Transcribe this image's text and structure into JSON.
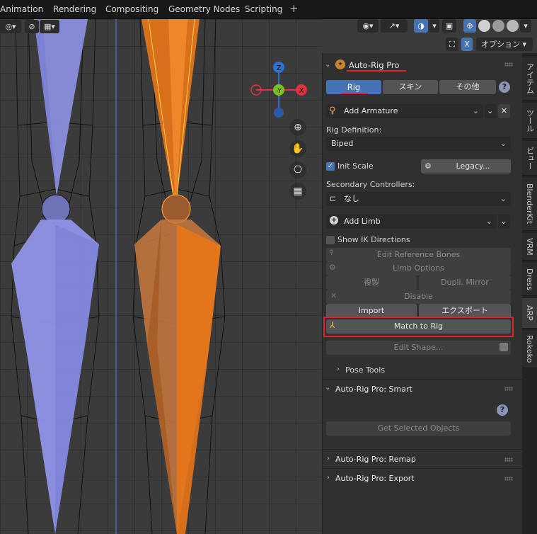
{
  "workspace_tabs": [
    "Animation",
    "Rendering",
    "Compositing",
    "Geometry Nodes",
    "Scripting"
  ],
  "add_workspace_label": "+",
  "header": {
    "view_mode_icon": "viewport-select-icon",
    "options_label": "オプション",
    "x_label": "X"
  },
  "gizmo": {
    "z": "Z",
    "y": "-Y",
    "x": "X"
  },
  "colors": {
    "accent": "#4772b3",
    "highlight_red": "#e0232e",
    "bone_blue": "#8f94e6",
    "bone_orange": "#e8751a"
  },
  "panel": {
    "title": "Auto-Rig Pro",
    "tabs": [
      "Rig",
      "スキン",
      "その他"
    ],
    "help_label": "?",
    "add_armature": "Add Armature",
    "close_label": "✕",
    "rig_definition_label": "Rig Definition:",
    "rig_definition_value": "Biped",
    "init_scale_label": "Init Scale",
    "legacy_label": "Legacy...",
    "secondary_label": "Secondary Controllers:",
    "secondary_value": "なし",
    "add_limb": "Add Limb",
    "show_ik_label": "Show IK Directions",
    "edit_reference_bones": "Edit Reference Bones",
    "limb_options": "Limb Options",
    "mirror_copy": "複製",
    "dupli_mirror": "Dupli. Mirror",
    "disable": "Disable",
    "import_label": "Import",
    "export_label": "エクスポート",
    "match_to_rig": "Match to Rig",
    "edit_shape": "Edit Shape...",
    "pose_tools": "Pose Tools",
    "smart_title": "Auto-Rig Pro: Smart",
    "get_selected": "Get Selected Objects",
    "remap_title": "Auto-Rig Pro: Remap",
    "export_title": "Auto-Rig Pro: Export"
  },
  "side_tabs": [
    "アイテム",
    "ツール",
    "ビュー",
    "BlenderKit",
    "VRM",
    "Dress",
    "ARP",
    "Rokoko"
  ]
}
